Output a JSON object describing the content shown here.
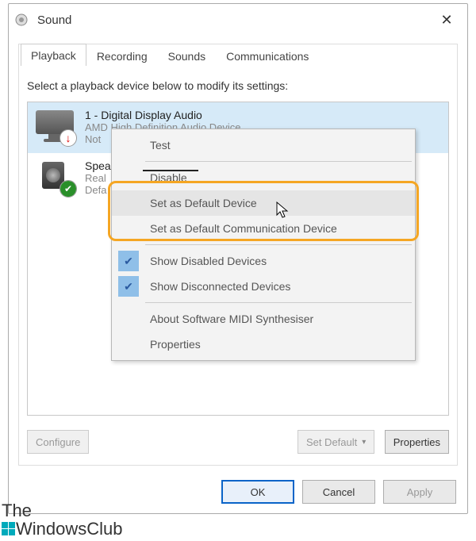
{
  "title": "Sound",
  "tabs": [
    "Playback",
    "Recording",
    "Sounds",
    "Communications"
  ],
  "instruction": "Select a playback device below to modify its settings:",
  "devices": [
    {
      "name": "1 - Digital Display Audio",
      "sub1": "AMD High Definition Audio Device",
      "sub2": "Not"
    },
    {
      "name": "Spea",
      "sub1": "Real",
      "sub2": "Defa"
    }
  ],
  "buttons": {
    "configure": "Configure",
    "setdefault": "Set Default",
    "properties": "Properties",
    "ok": "OK",
    "cancel": "Cancel",
    "apply": "Apply"
  },
  "context": {
    "test": "Test",
    "disable": "Disable",
    "setdefault": "Set as Default Device",
    "setdefaultcomm": "Set as Default Communication Device",
    "showdisabled": "Show Disabled Devices",
    "showdisconnected": "Show Disconnected Devices",
    "aboutmidi": "About Software MIDI Synthesiser",
    "props": "Properties"
  },
  "watermark": {
    "l1": "The",
    "l2": "WindowsClub"
  }
}
